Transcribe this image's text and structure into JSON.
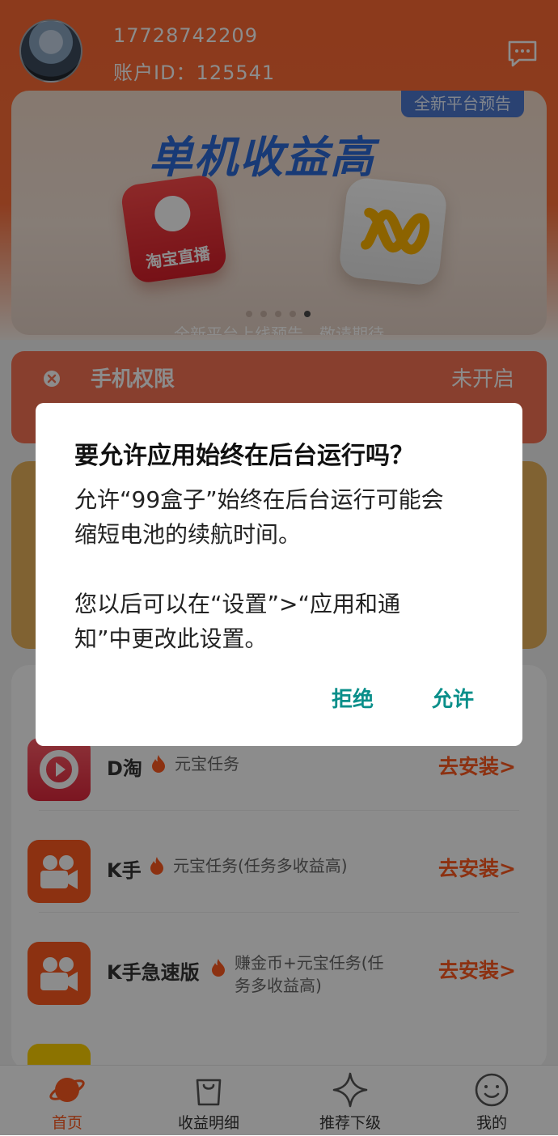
{
  "header": {
    "phone": "17728742209",
    "account_id": "账户ID：125541"
  },
  "banner": {
    "title": "单机收益高",
    "tag": "全新平台预告",
    "app1_label": "淘宝直播",
    "subtitle": "全新平台上线预告，敬请期待"
  },
  "permission": {
    "title": "手机权限",
    "status": "未开启"
  },
  "tasks": [
    {
      "name": "D淘",
      "desc": "元宝任务",
      "action": "去安装>"
    },
    {
      "name": "K手",
      "desc": "元宝任务(任务多收益高)",
      "action": "去安装>"
    },
    {
      "name": "K手急速版",
      "desc_line1": "赚金币+元宝任务(任",
      "desc_line2": "务多收益高)",
      "action": "去安装>"
    }
  ],
  "tabbar": {
    "home": "首页",
    "earnings": "收益明细",
    "referral": "推荐下级",
    "mine": "我的"
  },
  "dialog": {
    "title": "要允许应用始终在后台运行吗？",
    "body_line1": "允许“99盒子”始终在后台运行可能会",
    "body_line2": "缩短电池的续航时间。",
    "body_line3": "您以后可以在“设置”>“应用和通",
    "body_line4": "知”中更改此设置。",
    "deny": "拒绝",
    "allow": "允许"
  },
  "colors": {
    "primary": "#ff6a33",
    "install": "#ff5a1f",
    "dialog_button": "#0a8f8a"
  }
}
